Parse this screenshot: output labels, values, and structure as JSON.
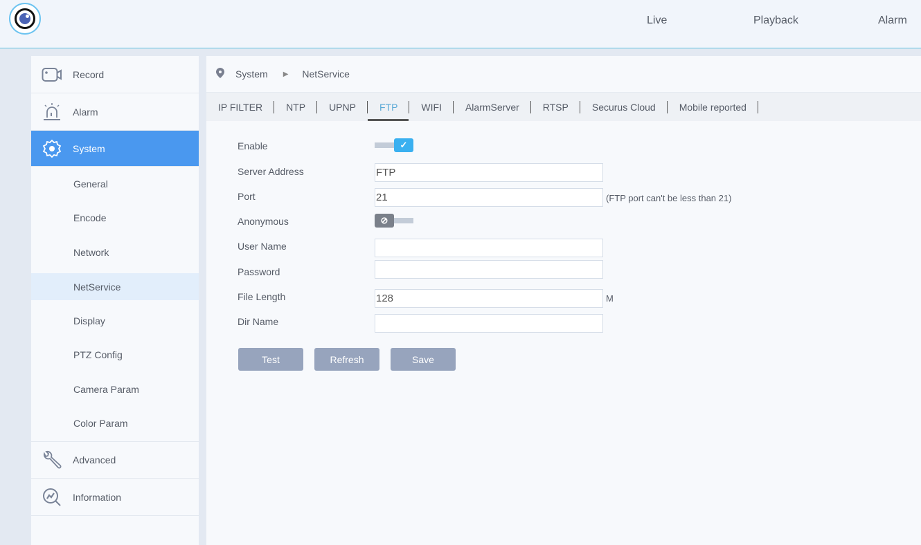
{
  "header": {
    "nav": [
      "Live",
      "Playback",
      "Alarm"
    ]
  },
  "sidebar": {
    "main_top": [
      {
        "label": "Record",
        "icon": "camera-icon"
      },
      {
        "label": "Alarm",
        "icon": "siren-icon"
      },
      {
        "label": "System",
        "icon": "gear-icon"
      }
    ],
    "sub": [
      "General",
      "Encode",
      "Network",
      "NetService",
      "Display",
      "PTZ Config",
      "Camera Param",
      "Color Param"
    ],
    "main_bottom": [
      {
        "label": "Advanced",
        "icon": "wrench-icon"
      },
      {
        "label": "Information",
        "icon": "info-chart-icon"
      }
    ]
  },
  "breadcrumb": [
    "System",
    "NetService"
  ],
  "tabs": [
    "IP FILTER",
    "NTP",
    "UPNP",
    "FTP",
    "WIFI",
    "AlarmServer",
    "RTSP",
    "Securus Cloud",
    "Mobile reported"
  ],
  "active_tab": "FTP",
  "form": {
    "enable_label": "Enable",
    "enable": true,
    "server_label": "Server Address",
    "server": "FTP",
    "port_label": "Port",
    "port": "21",
    "port_hint": "(FTP port can't be less than 21)",
    "anonymous_label": "Anonymous",
    "anonymous": false,
    "user_label": "User Name",
    "user": "",
    "password_label": "Password",
    "password": "",
    "file_length_label": "File Length",
    "file_length": "128",
    "file_length_unit": "M",
    "dir_label": "Dir Name",
    "dir": ""
  },
  "buttons": {
    "test": "Test",
    "refresh": "Refresh",
    "save": "Save"
  },
  "colors": {
    "accent": "#4a98ef",
    "toggle_on": "#3ab0f0"
  }
}
